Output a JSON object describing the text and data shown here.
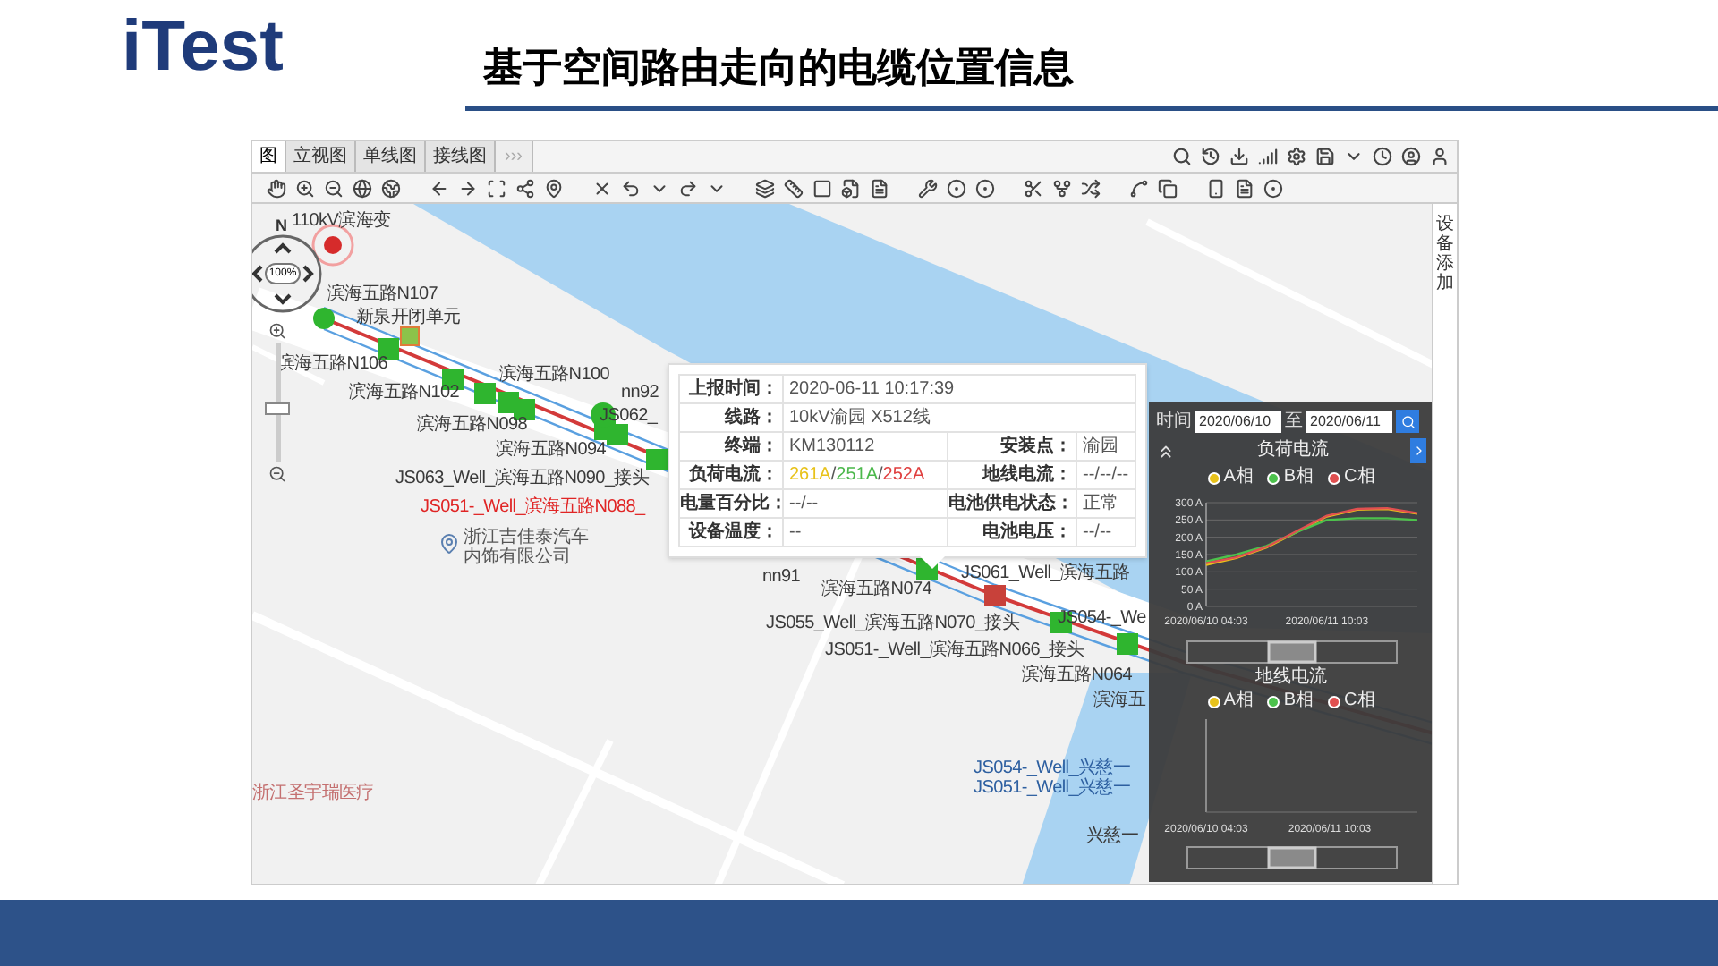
{
  "logo": {
    "text": "iTest"
  },
  "title": "基于空间路由走向的电缆位置信息",
  "app": {
    "tabs": [
      {
        "label": "图",
        "selected": true
      },
      {
        "label": "立视图",
        "selected": false
      },
      {
        "label": "单线图",
        "selected": false
      },
      {
        "label": "接线图",
        "selected": false
      }
    ],
    "tab_overflow": "›››",
    "side_label": "设备添加",
    "map": {
      "compass_label": "N",
      "zoom_percent": "100%",
      "zoom_slider": {
        "level": 0.46
      },
      "labels": [
        {
          "text": "110kV滨海变",
          "kind": "normal"
        },
        {
          "text": "滨海五路N107",
          "kind": "normal"
        },
        {
          "text": "新泉开闭单元",
          "kind": "normal"
        },
        {
          "text": "滨海五路N106",
          "kind": "normal"
        },
        {
          "text": "滨海五路N102",
          "kind": "normal"
        },
        {
          "text": "滨海五路N100",
          "kind": "normal"
        },
        {
          "text": "滨海五路N098",
          "kind": "normal"
        },
        {
          "text": "nn92",
          "kind": "normal"
        },
        {
          "text": "JS062_",
          "kind": "normal"
        },
        {
          "text": "滨海五路N094",
          "kind": "normal"
        },
        {
          "text": "JS063_Well_滨海五路N090_接头",
          "kind": "normal"
        },
        {
          "text": "JS051-_Well_滨海五路N088_",
          "kind": "alert"
        },
        {
          "text": "nn91",
          "kind": "normal"
        },
        {
          "text": "滨海五路N074",
          "kind": "normal"
        },
        {
          "text": "JS061_Well_滨海五路",
          "kind": "normal"
        },
        {
          "text": "JS055_Well_滨海五路N070_接头",
          "kind": "normal"
        },
        {
          "text": "JS054-_We",
          "kind": "normal"
        },
        {
          "text": "JS051-_Well_滨海五路N066_接头",
          "kind": "normal"
        },
        {
          "text": "滨海五路N064",
          "kind": "normal"
        },
        {
          "text": "滨海五",
          "kind": "normal"
        },
        {
          "text": "JS054-_Well_兴慈一",
          "kind": "water"
        },
        {
          "text": "JS051-_Well_兴慈一",
          "kind": "water"
        },
        {
          "text": "兴慈一",
          "kind": "normal"
        },
        {
          "text": "浙江圣宇瑞医疗",
          "kind": "faint"
        }
      ],
      "poi": {
        "lines": [
          "浙江吉佳泰汽车",
          "内饰有限公司"
        ]
      }
    },
    "popup": {
      "rows": [
        {
          "cells": [
            {
              "label": "上报时间：",
              "value": "2020-06-11 10:17:39"
            }
          ]
        },
        {
          "cells": [
            {
              "label": "线路：",
              "value": "10kV渝园 X512线"
            }
          ]
        },
        {
          "cells": [
            {
              "label": "终端：",
              "value": "KM130112"
            },
            {
              "label": "安装点：",
              "value": "渝园"
            }
          ]
        },
        {
          "cells": [
            {
              "label": "负荷电流：",
              "value_parts": [
                {
                  "text": "261A",
                  "color": "#e8c21a"
                },
                {
                  "text": "/"
                },
                {
                  "text": "251A",
                  "color": "#4cb84c"
                },
                {
                  "text": "/"
                },
                {
                  "text": "252A",
                  "color": "#e04040"
                }
              ]
            },
            {
              "label": "地线电流：",
              "value": "--/--/--"
            }
          ]
        },
        {
          "cells": [
            {
              "label": "电量百分比：",
              "value": "--/--"
            },
            {
              "label": "电池供电状态：",
              "value": "正常"
            }
          ]
        },
        {
          "cells": [
            {
              "label": "设备温度：",
              "value": "--"
            },
            {
              "label": "电池电压：",
              "value": "--/--"
            }
          ]
        }
      ]
    },
    "trend_panel": {
      "time_label": "时间",
      "start_date": "2020/06/10",
      "range_sep": "至",
      "end_date": "2020/06/11",
      "load_chart": {
        "chart_data": {
          "type": "line",
          "title": "负荷电流",
          "grid": true,
          "categories": [
            "2020/06/10 04:03",
            null,
            null,
            null,
            "2020/06/11 10:03",
            null,
            null,
            null
          ],
          "series": [
            {
              "name": "A相",
              "color": "#e8c21a",
              "values": [
                120,
                140,
                170,
                215,
                260,
                280,
                282,
                268
              ]
            },
            {
              "name": "B相",
              "color": "#4cc24c",
              "values": [
                130,
                150,
                175,
                215,
                250,
                255,
                255,
                250
              ]
            },
            {
              "name": "C相",
              "color": "#e05050",
              "values": [
                125,
                142,
                172,
                218,
                262,
                282,
                284,
                270
              ]
            }
          ],
          "ylim": [
            0,
            300
          ],
          "yticks": [
            {
              "value": 0,
              "label": "0 A"
            },
            {
              "value": 50,
              "label": "50 A"
            },
            {
              "value": 100,
              "label": "100 A"
            },
            {
              "value": 150,
              "label": "150 A"
            },
            {
              "value": 200,
              "label": "200 A"
            },
            {
              "value": 250,
              "label": "250 A"
            },
            {
              "value": 300,
              "label": "300 A"
            }
          ]
        }
      },
      "ground_chart": {
        "title": "地线电流",
        "legend": [
          {
            "name": "A相",
            "color": "#e8c21a"
          },
          {
            "name": "B相",
            "color": "#4cc24c"
          },
          {
            "name": "C相",
            "color": "#e05050"
          }
        ],
        "x_labels": [
          "2020/06/10 04:03",
          "2020/06/11 10:03"
        ]
      }
    }
  }
}
